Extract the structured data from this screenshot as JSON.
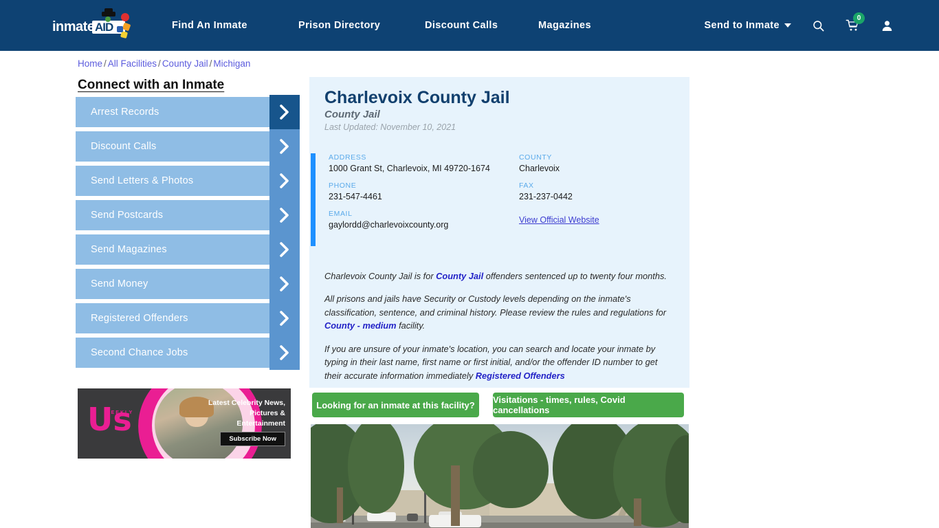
{
  "brand": {
    "logo_text": "inmate",
    "logo_badge": "AID",
    "colors": {
      "header": "#0e4273",
      "accent_blue": "#1e90ff",
      "green": "#4aa94a",
      "card_bg": "#e7f3fc"
    }
  },
  "nav": {
    "items": [
      {
        "label": "Find An Inmate"
      },
      {
        "label": "Prison Directory"
      },
      {
        "label": "Discount Calls"
      },
      {
        "label": "Magazines"
      }
    ],
    "dropdown": {
      "label": "Send to Inmate"
    },
    "icons": {
      "search": "search-icon",
      "cart": "shopping-cart-icon",
      "account": "user-account-icon"
    },
    "cart_count": "0"
  },
  "breadcrumb": {
    "items": [
      {
        "label": "Home"
      },
      {
        "label": "All Facilities"
      },
      {
        "label": "County Jail"
      },
      {
        "label": "Michigan"
      }
    ],
    "separator": "/"
  },
  "sidebar": {
    "title": "Connect with an Inmate",
    "items": [
      {
        "label": "Arrest Records"
      },
      {
        "label": "Discount Calls"
      },
      {
        "label": "Send Letters & Photos"
      },
      {
        "label": "Send Postcards"
      },
      {
        "label": "Send Magazines"
      },
      {
        "label": "Send Money"
      },
      {
        "label": "Registered Offenders"
      },
      {
        "label": "Second Chance Jobs"
      }
    ]
  },
  "ad": {
    "logo": "Us",
    "logo_sub": "WEEKLY",
    "copy": "Latest Celebrity News, Pictures & Entertainment",
    "cta": "Subscribe Now"
  },
  "facility": {
    "title": "Charlevoix County Jail",
    "subtitle": "County Jail",
    "last_updated": "Last Updated: November 10, 2021",
    "info": {
      "address_label": "ADDRESS",
      "address_value": "1000 Grant St, Charlevoix, MI 49720-1674",
      "county_label": "COUNTY",
      "county_value": "Charlevoix",
      "phone_label": "PHONE",
      "phone_value": "231-547-4461",
      "fax_label": "FAX",
      "fax_value": "231-237-0442",
      "email_label": "EMAIL",
      "email_value": "gaylordd@charlevoixcounty.org",
      "website_link": "View Official Website"
    },
    "paragraphs": {
      "p1_a": "Charlevoix County Jail is for ",
      "p1_link": "County Jail",
      "p1_b": " offenders sentenced up to twenty four months.",
      "p2_a": "All prisons and jails have Security or Custody levels depending on the inmate's classification, sentence, and criminal history. Please review the rules and regulations for ",
      "p2_link": "County - medium",
      "p2_b": " facility.",
      "p3_a": "If you are unsure of your inmate's location, you can search and locate your inmate by typing in their last name, first name or first initial, and/or the offender ID number to get their accurate information immediately ",
      "p3_link": "Registered Offenders"
    }
  },
  "actions": {
    "find_inmate": "Looking for an inmate at this facility?",
    "visitations": "Visitations - times, rules, Covid cancellations"
  }
}
